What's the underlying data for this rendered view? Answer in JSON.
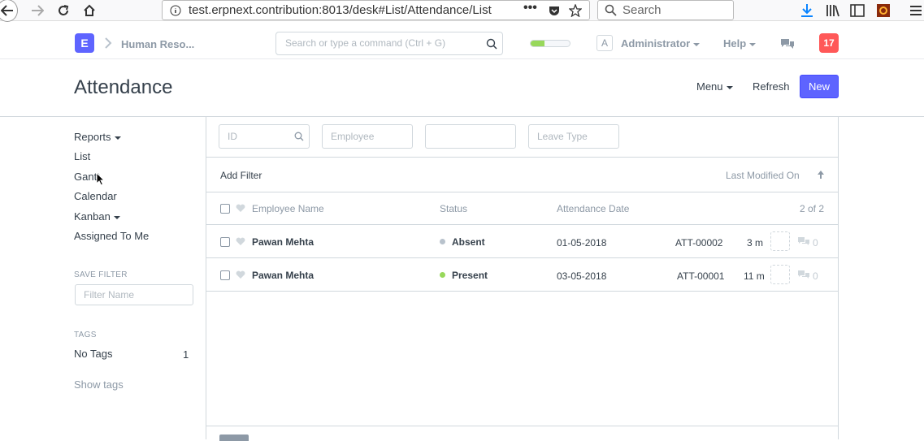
{
  "browser": {
    "url": "test.erpnext.contribution:8013/desk#List/Attendance/List",
    "search_placeholder": "Search"
  },
  "navbar": {
    "logo_letter": "E",
    "breadcrumb": "Human Reso...",
    "search_placeholder": "Search or type a command (Ctrl + G)",
    "progress": 0.35,
    "avatar_letter": "A",
    "user_label": "Administrator",
    "help_label": "Help",
    "notification_count": "17"
  },
  "page": {
    "title": "Attendance",
    "menu_label": "Menu",
    "refresh_label": "Refresh",
    "new_label": "New"
  },
  "sidebar": {
    "items": [
      {
        "label": "Reports",
        "dropdown": true
      },
      {
        "label": "List",
        "dropdown": false
      },
      {
        "label": "Gantt",
        "dropdown": false
      },
      {
        "label": "Calendar",
        "dropdown": false
      },
      {
        "label": "Kanban",
        "dropdown": true
      },
      {
        "label": "Assigned To Me",
        "dropdown": false
      }
    ],
    "save_filter_label": "SAVE FILTER",
    "filter_name_placeholder": "Filter Name",
    "tags_label": "TAGS",
    "no_tags_label": "No Tags",
    "no_tags_count": "1",
    "show_tags_label": "Show tags"
  },
  "filters": {
    "id_placeholder": "ID",
    "employee_placeholder": "Employee",
    "blank_placeholder": "",
    "leave_type_placeholder": "Leave Type",
    "add_filter_label": "Add Filter",
    "sort_label": "Last Modified On"
  },
  "list": {
    "columns": {
      "name": "Employee Name",
      "status": "Status",
      "date": "Attendance Date"
    },
    "count": "2 of 2",
    "rows": [
      {
        "name": "Pawan Mehta",
        "status": "Absent",
        "status_color": "#b8c2cc",
        "date": "01-05-2018",
        "id": "ATT-00002",
        "modified": "3 m",
        "comments": "0"
      },
      {
        "name": "Pawan Mehta",
        "status": "Present",
        "status_color": "#98d85b",
        "date": "03-05-2018",
        "id": "ATT-00001",
        "modified": "11 m",
        "comments": "0"
      }
    ]
  }
}
